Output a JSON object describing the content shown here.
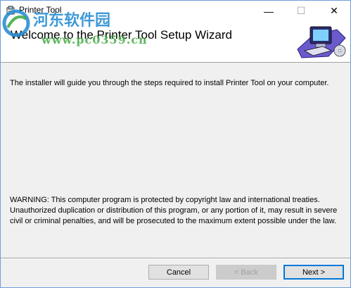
{
  "window": {
    "title": "Printer Tool",
    "minimize_glyph": "—",
    "maximize_glyph": "☐",
    "close_glyph": "✕"
  },
  "header": {
    "title": "Welcome to the Printer Tool Setup Wizard",
    "graphic_icon": "computer-setup-icon"
  },
  "body": {
    "intro": "The installer will guide you through the steps required to install Printer Tool on your computer.",
    "warning": "WARNING: This computer program is protected by copyright law and international treaties. Unauthorized duplication or distribution of this program, or any portion of it, may result in severe civil or criminal penalties, and will be prosecuted to the maximum extent possible under the law."
  },
  "watermark": {
    "site_name": "河东软件园",
    "url": "www.pc0359.cn"
  },
  "buttons": {
    "cancel": "Cancel",
    "back": "< Back",
    "next": "Next >"
  },
  "colors": {
    "accent": "#0078d7",
    "watermark_blue": "#1e88d2",
    "watermark_green": "#3aa63a"
  }
}
